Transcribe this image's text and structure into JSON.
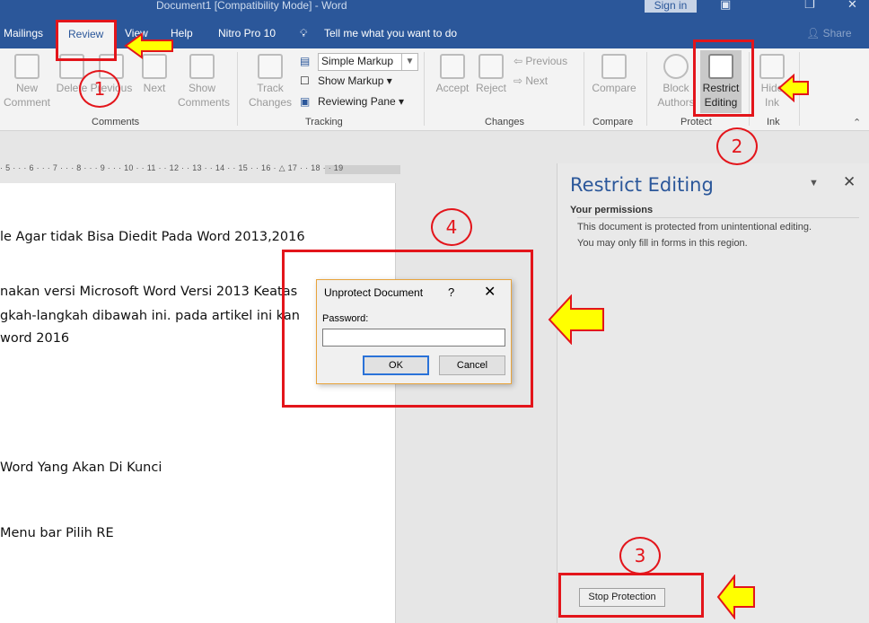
{
  "window": {
    "title": "Document1 [Compatibility Mode]  -  Word",
    "sign_in": "Sign in",
    "restore_glyph": "▣",
    "maximize_glyph": "❐",
    "close_glyph": "✕"
  },
  "tabs": {
    "mailings": "Mailings",
    "review": "Review",
    "view": "View",
    "help": "Help",
    "nitro": "Nitro Pro 10",
    "tell_me": "Tell me what you want to do",
    "share": "Share"
  },
  "ribbon": {
    "comments": {
      "new_comment": "New Comment",
      "new_1": "New",
      "new_2": "Comment",
      "delete": "Delete",
      "previous": "Previous",
      "next": "Next",
      "show_1": "Show",
      "show_2": "Comments",
      "group": "Comments"
    },
    "tracking": {
      "track_1": "Track",
      "track_2": "Changes",
      "markup_value": "Simple Markup",
      "show_markup": "Show Markup",
      "reviewing_pane": "Reviewing Pane",
      "group": "Tracking"
    },
    "changes": {
      "accept": "Accept",
      "reject": "Reject",
      "previous": "Previous",
      "next": "Next",
      "group": "Changes"
    },
    "compare": {
      "compare": "Compare",
      "group": "Compare"
    },
    "protect": {
      "block_1": "Block",
      "block_2": "Authors",
      "restrict_1": "Restrict",
      "restrict_2": "Editing",
      "group": "Protect"
    },
    "ink": {
      "hide_1": "Hide",
      "hide_2": "Ink",
      "group": "Ink"
    }
  },
  "ruler": {
    "text": "· 5 · · · 6 · · · 7 · · · 8 · · · 9 · · · 10 · · 11 · · 12 · · 13 · · 14 · · 15 · · 16 · △ 17 · · 18 · · 19"
  },
  "document": {
    "lines": [
      "le Agar tidak Bisa Diedit Pada Word 2013,2016",
      "nakan versi Microsoft Word Versi 2013 Keatas",
      "gkah-langkah dibawah ini. pada artikel ini kan",
      " word 2016",
      "Word Yang Akan Di Kunci",
      " Menu bar Pilih RE"
    ]
  },
  "restrict_pane": {
    "title": "Restrict Editing",
    "permissions_heading": "Your permissions",
    "text_1": "This document is protected from unintentional editing.",
    "text_2": "You may only fill in forms in this region.",
    "stop_protection": "Stop Protection"
  },
  "dialog": {
    "title": "Unprotect Document",
    "help": "?",
    "close": "✕",
    "password_label": "Password:",
    "password_value": "",
    "ok": "OK",
    "cancel": "Cancel"
  },
  "annotations": {
    "step_1": "1",
    "step_2": "2",
    "step_3": "3",
    "step_4": "4",
    "color": "#e3151b",
    "arrow_color": "#ffff00"
  }
}
